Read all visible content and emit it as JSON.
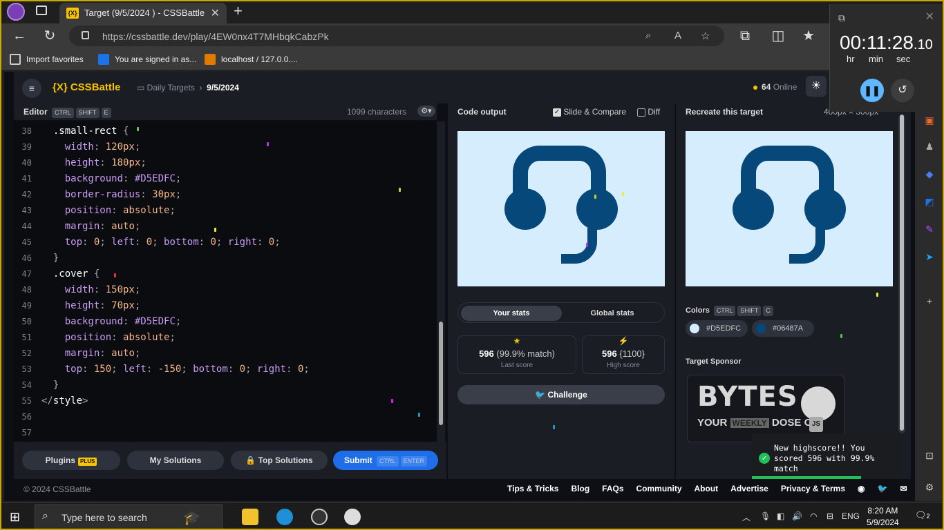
{
  "browser": {
    "tab_title": "Target (9/5/2024 ) - CSSBattle",
    "tab_favicon": "{X}",
    "url": "https://cssbattle.dev/play/4EW0nx4T7MHbqkCabzPk",
    "favorites": [
      {
        "label": "Import favorites"
      },
      {
        "label": "You are signed in as..."
      },
      {
        "label": "localhost / 127.0.0...."
      }
    ]
  },
  "timer": {
    "time": "00:11:28",
    "fraction": ".10",
    "units": [
      "hr",
      "min",
      "sec"
    ]
  },
  "header": {
    "logo": "{X} CSSBattle",
    "crumb_parent": "Daily Targets",
    "crumb_current": "9/5/2024",
    "online_count": "64",
    "online_label": "Online"
  },
  "editor": {
    "title": "Editor",
    "shortcut": [
      "CTRL",
      "SHIFT",
      "E"
    ],
    "chars": "1099 characters",
    "lines": [
      {
        "n": "38",
        "fold": true,
        "parts": [
          [
            "sel",
            "  .small-rect "
          ],
          [
            "tag",
            "{"
          ]
        ]
      },
      {
        "n": "39",
        "parts": [
          [
            "prop",
            "    width"
          ],
          [
            "tag",
            ": "
          ],
          [
            "num",
            "120px"
          ],
          [
            "tag",
            ";"
          ]
        ]
      },
      {
        "n": "40",
        "parts": [
          [
            "prop",
            "    height"
          ],
          [
            "tag",
            ": "
          ],
          [
            "num",
            "180px"
          ],
          [
            "tag",
            ";"
          ]
        ]
      },
      {
        "n": "41",
        "parts": [
          [
            "prop",
            "    background"
          ],
          [
            "tag",
            ": "
          ],
          [
            "prop",
            "#D5EDFC"
          ],
          [
            "tag",
            ";"
          ]
        ]
      },
      {
        "n": "42",
        "parts": [
          [
            "prop",
            "    border-radius"
          ],
          [
            "tag",
            ": "
          ],
          [
            "num",
            "30px"
          ],
          [
            "tag",
            ";"
          ]
        ]
      },
      {
        "n": "43",
        "parts": [
          [
            "prop",
            "    position"
          ],
          [
            "tag",
            ": "
          ],
          [
            "val",
            "absolute"
          ],
          [
            "tag",
            ";"
          ]
        ]
      },
      {
        "n": "44",
        "parts": [
          [
            "prop",
            "    margin"
          ],
          [
            "tag",
            ": "
          ],
          [
            "val",
            "auto"
          ],
          [
            "tag",
            ";"
          ]
        ]
      },
      {
        "n": "45",
        "parts": [
          [
            "prop",
            "    top"
          ],
          [
            "tag",
            ": "
          ],
          [
            "num",
            "0"
          ],
          [
            "tag",
            "; "
          ],
          [
            "prop",
            "left"
          ],
          [
            "tag",
            ": "
          ],
          [
            "num",
            "0"
          ],
          [
            "tag",
            "; "
          ],
          [
            "prop",
            "bottom"
          ],
          [
            "tag",
            ": "
          ],
          [
            "num",
            "0"
          ],
          [
            "tag",
            "; "
          ],
          [
            "prop",
            "right"
          ],
          [
            "tag",
            ": "
          ],
          [
            "num",
            "0"
          ],
          [
            "tag",
            ";"
          ]
        ]
      },
      {
        "n": "46",
        "parts": [
          [
            "tag",
            "  }"
          ]
        ]
      },
      {
        "n": "47",
        "fold": true,
        "parts": [
          [
            "sel",
            "  .cover "
          ],
          [
            "tag",
            "{"
          ]
        ]
      },
      {
        "n": "48",
        "parts": [
          [
            "prop",
            "    width"
          ],
          [
            "tag",
            ": "
          ],
          [
            "num",
            "150px"
          ],
          [
            "tag",
            ";"
          ]
        ]
      },
      {
        "n": "49",
        "parts": [
          [
            "prop",
            "    height"
          ],
          [
            "tag",
            ": "
          ],
          [
            "num",
            "70px"
          ],
          [
            "tag",
            ";"
          ]
        ]
      },
      {
        "n": "50",
        "parts": [
          [
            "prop",
            "    background"
          ],
          [
            "tag",
            ": "
          ],
          [
            "prop",
            "#D5EDFC"
          ],
          [
            "tag",
            ";"
          ]
        ]
      },
      {
        "n": "51",
        "parts": [
          [
            "prop",
            "    position"
          ],
          [
            "tag",
            ": "
          ],
          [
            "val",
            "absolute"
          ],
          [
            "tag",
            ";"
          ]
        ]
      },
      {
        "n": "52",
        "parts": [
          [
            "prop",
            "    margin"
          ],
          [
            "tag",
            ": "
          ],
          [
            "val",
            "auto"
          ],
          [
            "tag",
            ";"
          ]
        ]
      },
      {
        "n": "53",
        "parts": [
          [
            "prop",
            "    top"
          ],
          [
            "tag",
            ": "
          ],
          [
            "num",
            "150"
          ],
          [
            "tag",
            "; "
          ],
          [
            "prop",
            "left"
          ],
          [
            "tag",
            ": "
          ],
          [
            "num",
            "-150"
          ],
          [
            "tag",
            "; "
          ],
          [
            "prop",
            "bottom"
          ],
          [
            "tag",
            ": "
          ],
          [
            "num",
            "0"
          ],
          [
            "tag",
            "; "
          ],
          [
            "prop",
            "right"
          ],
          [
            "tag",
            ": "
          ],
          [
            "num",
            "0"
          ],
          [
            "tag",
            ";"
          ]
        ]
      },
      {
        "n": "54",
        "parts": [
          [
            "tag",
            "  }"
          ]
        ]
      },
      {
        "n": "55",
        "parts": [
          [
            "tag",
            "</"
          ],
          [
            "sel",
            "style"
          ],
          [
            "tag",
            ">"
          ]
        ]
      },
      {
        "n": "56",
        "parts": []
      },
      {
        "n": "57",
        "parts": []
      }
    ],
    "buttons": {
      "plugins": "Plugins",
      "plugins_badge": "PLUS",
      "my_solutions": "My Solutions",
      "top_solutions": "Top Solutions",
      "submit": "Submit",
      "submit_keys": [
        "CTRL",
        "ENTER"
      ]
    }
  },
  "output": {
    "title": "Code output",
    "slide_compare": "Slide & Compare",
    "diff": "Diff",
    "tab_your": "Your stats",
    "tab_global": "Global stats",
    "last_score": "596",
    "last_match": "(99.9% match)",
    "last_label": "Last score",
    "high_score": "596",
    "high_extra": "{1100}",
    "high_label": "High score",
    "challenge": "Challenge"
  },
  "target": {
    "title": "Recreate this target",
    "size_hint": "400px × 300px",
    "colors_title": "Colors",
    "colors_keys": [
      "CTRL",
      "SHIFT",
      "C"
    ],
    "colors": [
      {
        "hex": "#D5EDFC",
        "label": "#D5EDFC"
      },
      {
        "hex": "#06487A",
        "label": "#06487A"
      }
    ],
    "sponsor_title": "Target Sponsor",
    "sponsor_line1": "BYTES",
    "sponsor_line2a": "YOUR",
    "sponsor_line2b": "WEEKLY",
    "sponsor_line2c": "DOSE OF",
    "sponsor_badge": "JS"
  },
  "toast": {
    "message": "New highscore!! You scored 596 with 99.9% match"
  },
  "footer": {
    "copyright": "© 2024 CSSBattle",
    "links": [
      "Tips & Tricks",
      "Blog",
      "FAQs",
      "Community",
      "About",
      "Advertise",
      "Privacy & Terms"
    ]
  },
  "taskbar": {
    "search_placeholder": "Type here to search",
    "lang": "ENG",
    "time": "8:20 AM",
    "date": "5/9/2024",
    "notifications": "2"
  },
  "accent": {
    "yellow": "#f6c400",
    "blue": "#1f6de8",
    "shape": "#06487A",
    "bg": "#D5EDFC"
  }
}
